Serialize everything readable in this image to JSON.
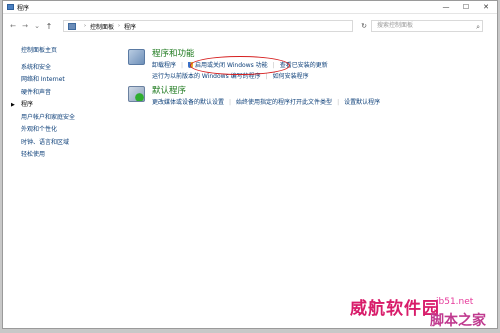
{
  "window": {
    "title": "程序",
    "minimize_label": "—",
    "maximize_label": "☐",
    "close_label": "✕"
  },
  "address": {
    "back": "←",
    "forward": "→",
    "recent": "⌄",
    "up": "↑",
    "breadcrumbs": [
      "控制面板",
      "程序"
    ],
    "breadcrumb_sep": "›",
    "refresh": "↻",
    "search_placeholder": "搜索控制面板",
    "search_icon_glyph": "⌕"
  },
  "sidebar": {
    "items": [
      {
        "label": "控制面板主页"
      },
      {
        "label": "系统和安全"
      },
      {
        "label": "网络和 Internet"
      },
      {
        "label": "硬件和声音"
      },
      {
        "label": "程序"
      },
      {
        "label": "用户帐户和家庭安全"
      },
      {
        "label": "外观和个性化"
      },
      {
        "label": "时钟、语言和区域"
      },
      {
        "label": "轻松使用"
      }
    ]
  },
  "programs_features": {
    "title": "程序和功能",
    "links_row1": [
      "卸载程序",
      "启用或关闭 Windows 功能",
      "查看已安装的更新"
    ],
    "links_row2": [
      "运行为以前版本的 Windows 编写的程序",
      "如何安装程序"
    ],
    "icon_color": "#8aa7c9"
  },
  "default_programs": {
    "title": "默认程序",
    "links": [
      "更改媒体或设备的默认设置",
      "始终使用指定的程序打开此文件类型",
      "设置默认程序"
    ],
    "icon_color": "#2f8a2f"
  },
  "watermark": {
    "main": "威航软件园",
    "site": "jb51.net",
    "brand": "脚本之家"
  },
  "colors": {
    "link": "#0b3e78",
    "section_title": "#1e7a1e",
    "annotation": "#d62020"
  }
}
